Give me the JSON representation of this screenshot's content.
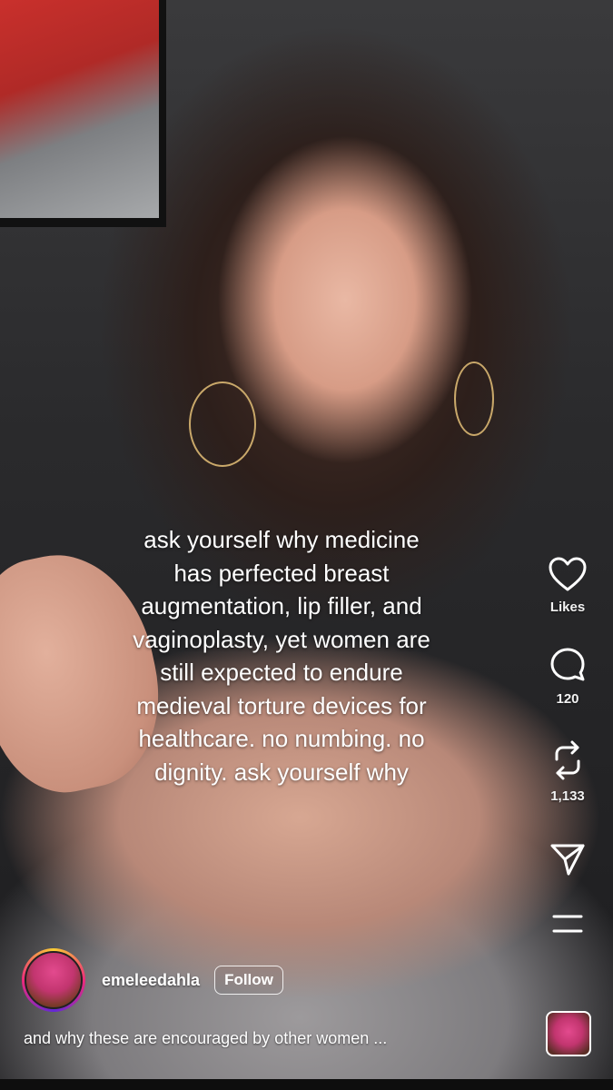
{
  "caption": {
    "lines": [
      "ask yourself why medicine",
      "has perfected breast",
      "augmentation, lip filler, and",
      "vaginoplasty, yet women are",
      "still expected to endure",
      "medieval torture devices for",
      "healthcare. no numbing. no",
      "dignity. ask yourself why"
    ]
  },
  "actions": {
    "likes_label": "Likes",
    "comments_count": "120",
    "reposts_count": "1,133"
  },
  "author": {
    "username": "emeleedahla",
    "follow_label": "Follow"
  },
  "description": "and why these are encouraged by other women ...",
  "colors": {
    "text": "#ffffff",
    "avatar_ring": [
      "#f9ce34",
      "#ee2a7b",
      "#6228d7"
    ]
  },
  "icons": [
    "heart-icon",
    "comment-icon",
    "repost-icon",
    "send-icon",
    "more-icon"
  ]
}
